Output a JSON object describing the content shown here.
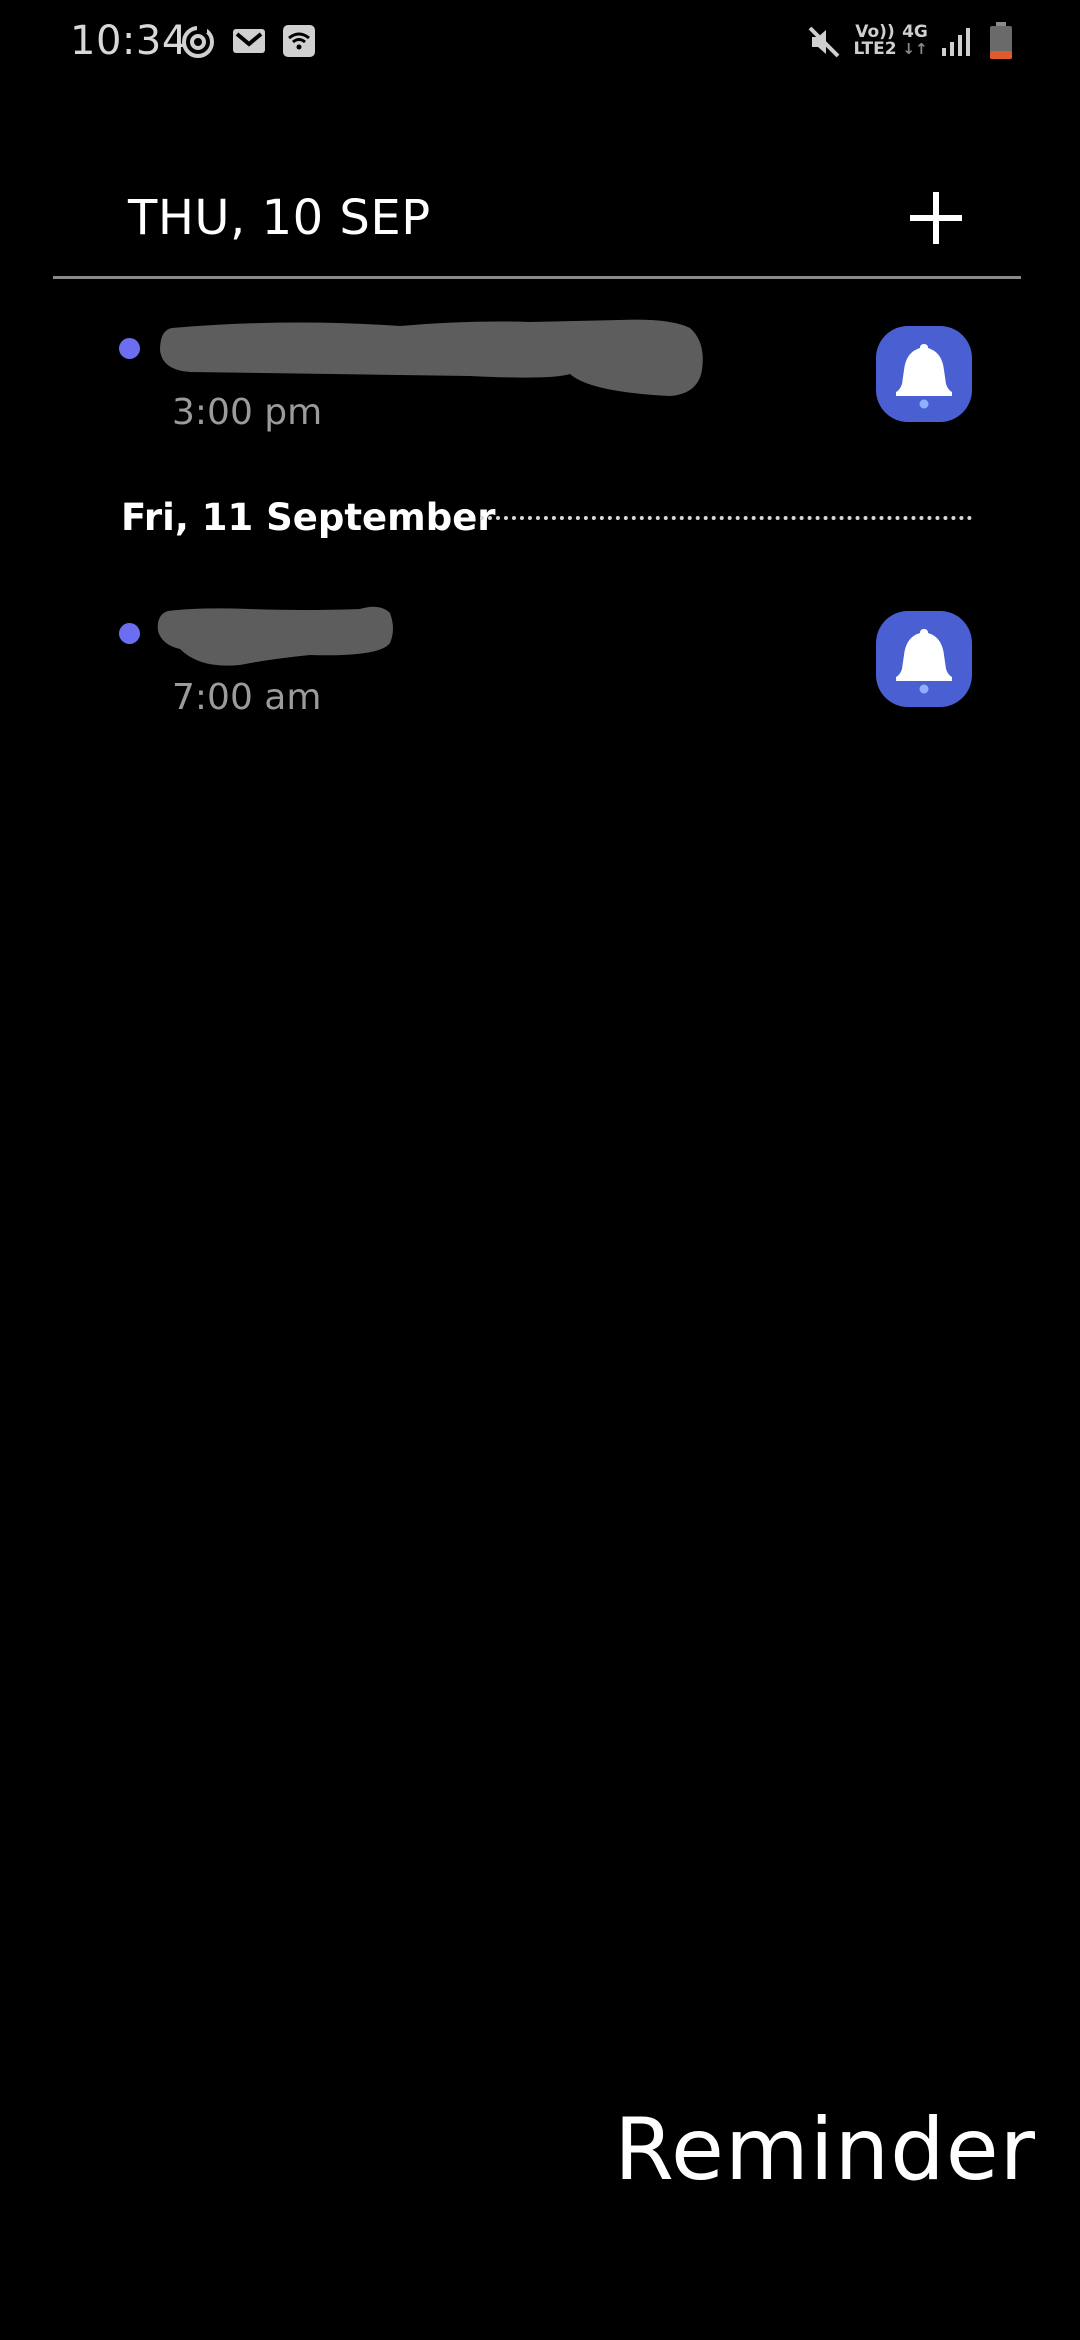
{
  "status_bar": {
    "time": "10:34",
    "notification_icons": [
      "sync-icon",
      "gmail-icon",
      "wifi-calling-icon"
    ],
    "system_icons": [
      "mute-icon",
      "volte-icon",
      "4g-icon",
      "signal-icon",
      "battery-icon"
    ],
    "volte_top": "Vo))",
    "volte_bottom": "LTE2",
    "network_label": "4G",
    "battery_color": "#e05a2b"
  },
  "header": {
    "date": "THU, 10 SEP",
    "add_icon": "plus-icon"
  },
  "reminders": [
    {
      "time": "3:00 pm",
      "title_redacted": true,
      "icon": "bell-icon",
      "accent": "#4a5fd1"
    },
    {
      "time": "7:00 am",
      "title_redacted": true,
      "icon": "bell-icon",
      "accent": "#4a5fd1"
    }
  ],
  "section": {
    "label": "Fri, 11 September"
  },
  "widget": {
    "label": "Reminder"
  },
  "colors": {
    "background": "#000000",
    "dot": "#6b6ef0",
    "bell_bg": "#4a5fd1",
    "redaction": "#5d5d5d"
  }
}
